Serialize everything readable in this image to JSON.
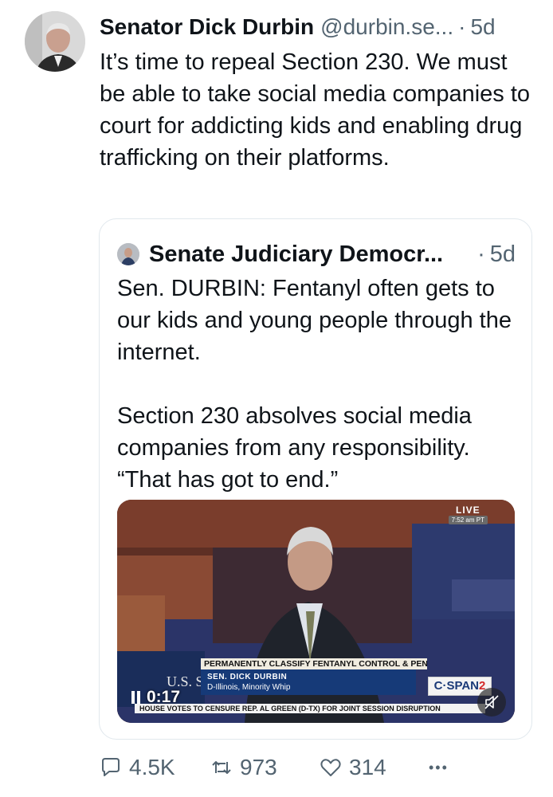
{
  "tweet": {
    "author_name": "Senator Dick Durbin",
    "author_handle": "@durbin.se...",
    "separator": "·",
    "time": "5d",
    "text": "It’s time to repeal Section 230. We must be able to take social media companies to court for addicting kids and enabling drug trafficking on their platforms."
  },
  "quote": {
    "author_name": "Senate Judiciary Democr...",
    "separator": "·",
    "time": "5d",
    "paragraph_1": "Sen. DURBIN: Fentanyl often gets to our kids and young people through the internet.",
    "paragraph_2": "Section 230 absolves social media companies from any responsibility. “That has got to end.”"
  },
  "video": {
    "live_label": "LIVE",
    "live_time": "7:52 am PT",
    "lower_third": "PERMANENTLY CLASSIFY FENTANYL CONTROL & PENALTIES",
    "speaker_name": "SEN. DICK DURBIN",
    "speaker_title": "D-Illinois, Minority Whip",
    "ticker": "HOUSE VOTES TO CENSURE REP. AL GREEN (D-TX) FOR JOINT SESSION DISRUPTION",
    "network_main": "C·SPAN",
    "network_num": "2",
    "chamber_text": "U.S. SE",
    "elapsed": "0:17"
  },
  "actions": {
    "replies": "4.5K",
    "reposts": "973",
    "likes": "314",
    "more": "•••"
  },
  "colors": {
    "text_primary": "#0f1419",
    "text_secondary": "#536471",
    "card_border": "#e1e8ed"
  }
}
